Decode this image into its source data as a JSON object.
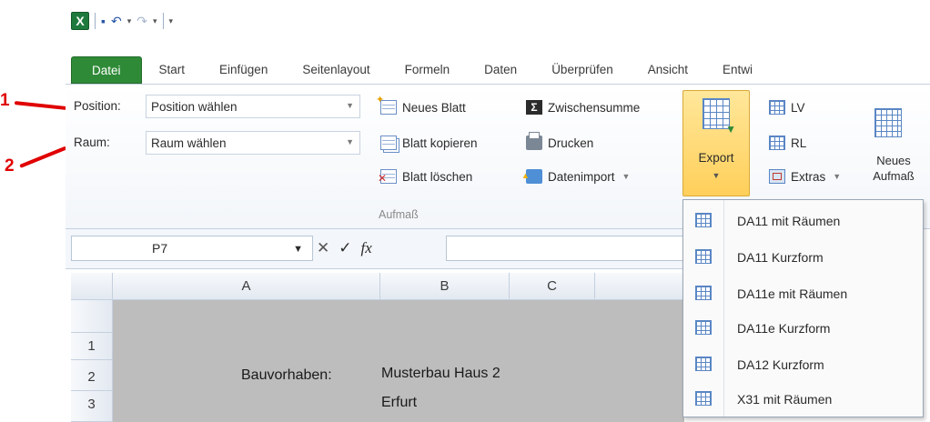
{
  "callouts": [
    "1",
    "2"
  ],
  "qat": {
    "logo": "X",
    "save": "▪",
    "undo": "↶",
    "redo": "↷",
    "caret": "▾"
  },
  "tabs": [
    "Datei",
    "Start",
    "Einfügen",
    "Seitenlayout",
    "Formeln",
    "Daten",
    "Überprüfen",
    "Ansicht",
    "Entwi"
  ],
  "ribbon": {
    "position_label": "Position:",
    "position_value": "Position wählen",
    "raum_label": "Raum:",
    "raum_value": "Raum wählen",
    "neues_blatt": "Neues Blatt",
    "blatt_kopieren": "Blatt kopieren",
    "blatt_loeschen": "Blatt löschen",
    "zwischensumme": "Zwischensumme",
    "drucken": "Drucken",
    "datenimport": "Datenimport",
    "export": "Export",
    "lv": "LV",
    "rl": "RL",
    "extras": "Extras",
    "neues_aufmass_line1": "Neues",
    "neues_aufmass_line2": "Aufmaß",
    "group_label": "Aufmaß"
  },
  "formula_bar": {
    "name_box": "P7",
    "cancel": "✕",
    "enter": "✓",
    "fx": "fx"
  },
  "columns": [
    "A",
    "B",
    "C"
  ],
  "rows": [
    "1",
    "2",
    "3"
  ],
  "cells": {
    "a2": "Bauvorhaben:",
    "b2": "Musterbau Haus 2",
    "b3": "Erfurt"
  },
  "export_menu": [
    "DA11 mit Räumen",
    "DA11 Kurzform",
    "DA11e mit Räumen",
    "DA11e Kurzform",
    "DA12 Kurzform",
    "X31 mit Räumen"
  ],
  "colors": {
    "file_tab": "#2f8a37",
    "callout": "#e00000",
    "export_highlight": "#ffcf5a"
  }
}
